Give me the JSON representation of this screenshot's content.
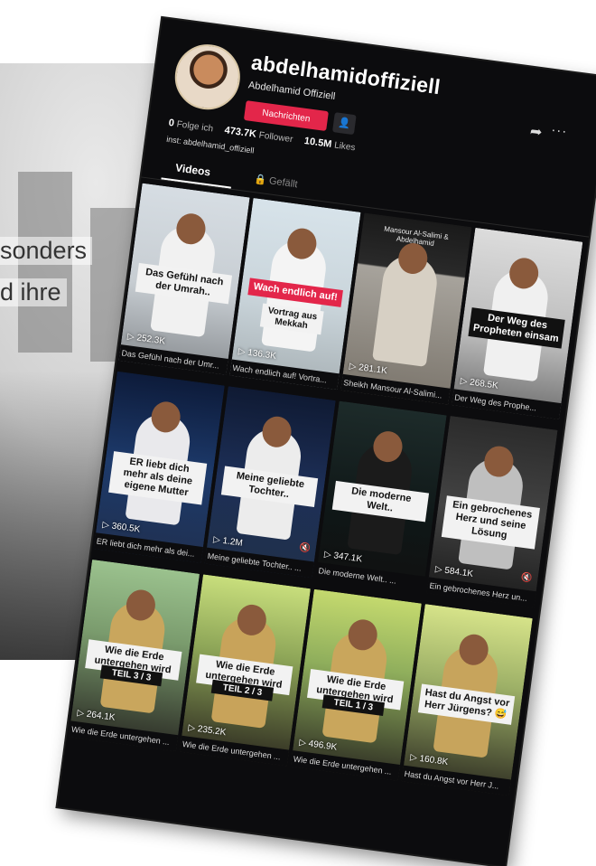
{
  "background_slide": {
    "text_line_1": "sonders",
    "text_line_2": "d ihre"
  },
  "profile": {
    "username": "abdelhamidoffiziell",
    "display_name": "Abdelhamid Offiziell",
    "message_button": "Nachrichten",
    "follow_friend_icon": "person-plus-icon",
    "share_icon": "share-arrow-icon",
    "more_icon": "more-dots-icon",
    "stats": {
      "following_value": "0",
      "following_label": "Folge ich",
      "followers_value": "473.7K",
      "followers_label": "Follower",
      "likes_value": "10.5M",
      "likes_label": "Likes"
    },
    "bio": "inst: abdelhamid_offiziell"
  },
  "tabs": {
    "videos": "Videos",
    "liked": "Gefällt"
  },
  "videos": [
    {
      "overlay": "Das Gefühl nach der Umrah..",
      "overlay_style": "light",
      "views": "252.3K",
      "caption": "Das Gefühl nach der Umr..."
    },
    {
      "overlay": "Wach endlich auf!",
      "overlay_sub": "Vortrag aus Mekkah",
      "overlay_style": "red",
      "views": "136.3K",
      "caption": "Wach endlich auf! Vortra..."
    },
    {
      "top_text": "Mansour Al-Salimi & Abdelhamid",
      "views": "281.1K",
      "caption": "Sheikh Mansour Al-Salimi..."
    },
    {
      "overlay": "Der Weg des Propheten einsam",
      "overlay_style": "dark",
      "views": "268.5K",
      "caption": "Der Weg des Prophe..."
    },
    {
      "overlay": "ER liebt dich mehr als deine eigene Mutter",
      "overlay_style": "light",
      "views": "360.5K",
      "caption": "ER liebt dich mehr als dei..."
    },
    {
      "overlay": "Meine geliebte Tochter..",
      "overlay_style": "light",
      "views": "1.2M",
      "caption": "Meine geliebte Tochter.. ..."
    },
    {
      "overlay": "Die moderne Welt..",
      "overlay_style": "light",
      "views": "347.1K",
      "caption": "Die moderne Welt.. ..."
    },
    {
      "overlay": "Ein gebrochenes Herz und seine Lösung",
      "overlay_style": "light",
      "views": "584.1K",
      "caption": "Ein gebrochenes Herz un..."
    },
    {
      "overlay": "Wie die Erde untergehen wird",
      "overlay_sub": "TEIL 3 / 3",
      "overlay_style": "light",
      "views": "264.1K",
      "caption": "Wie die Erde untergehen ..."
    },
    {
      "overlay": "Wie die Erde untergehen wird",
      "overlay_sub": "TEIL 2 / 3",
      "overlay_style": "light",
      "views": "235.2K",
      "caption": "Wie die Erde untergehen ..."
    },
    {
      "overlay": "Wie die Erde untergehen wird",
      "overlay_sub": "TEIL 1 / 3",
      "overlay_style": "light",
      "views": "496.9K",
      "caption": "Wie die Erde untergehen ..."
    },
    {
      "overlay": "Hast du Angst vor Herr Jürgens? 😅",
      "overlay_style": "light",
      "views": "160.8K",
      "caption": "Hast du Angst vor Herr J..."
    }
  ],
  "colors": {
    "accent_red": "#e3264a",
    "app_background": "#0c0c0e"
  }
}
